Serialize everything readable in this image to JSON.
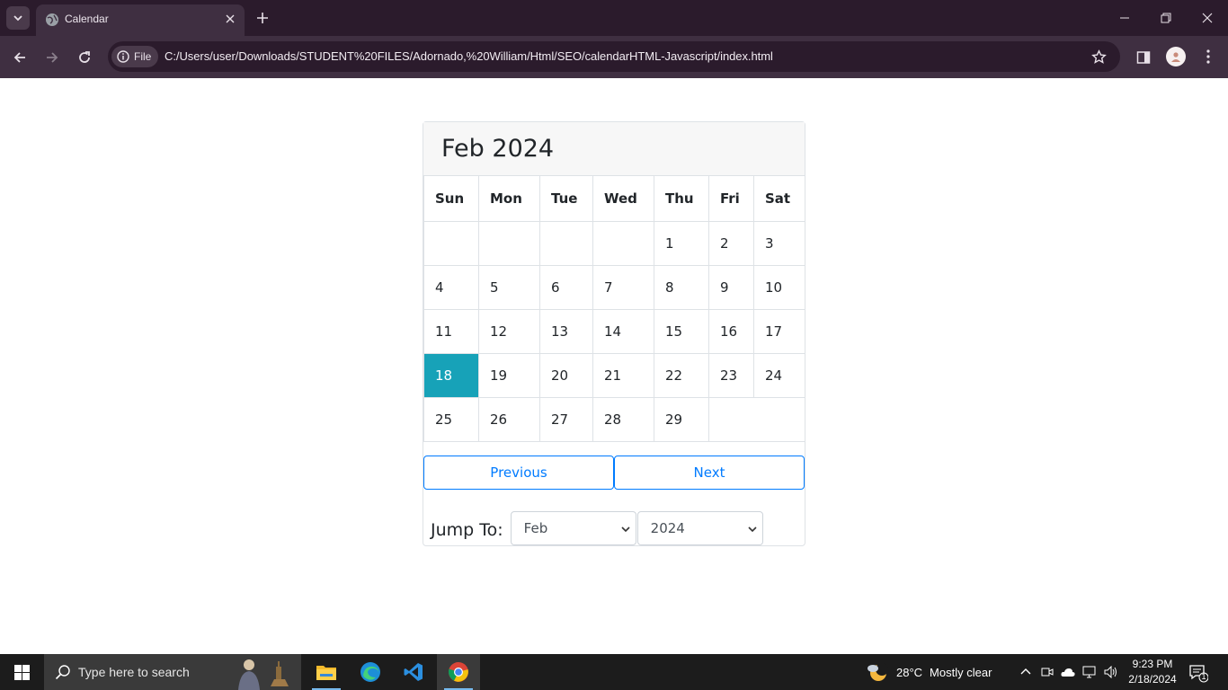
{
  "browser": {
    "tab_title": "Calendar",
    "site_chip_label": "File",
    "url": "C:/Users/user/Downloads/STUDENT%20FILES/Adornado,%20William/Html/SEO/calendarHTML-Javascript/index.html"
  },
  "calendar": {
    "title": "Feb 2024",
    "weekdays": [
      "Sun",
      "Mon",
      "Tue",
      "Wed",
      "Thu",
      "Fri",
      "Sat"
    ],
    "weeks": [
      [
        "",
        "",
        "",
        "",
        "1",
        "2",
        "3"
      ],
      [
        "4",
        "5",
        "6",
        "7",
        "8",
        "9",
        "10"
      ],
      [
        "11",
        "12",
        "13",
        "14",
        "15",
        "16",
        "17"
      ],
      [
        "18",
        "19",
        "20",
        "21",
        "22",
        "23",
        "24"
      ],
      [
        "25",
        "26",
        "27",
        "28",
        "29",
        "",
        ""
      ]
    ],
    "today": "18",
    "today_color": "#17a2b8",
    "previous_label": "Previous",
    "next_label": "Next",
    "jump_label": "Jump To:",
    "month_select_value": "Feb",
    "year_select_value": "2024",
    "accent_color": "#007bff"
  },
  "taskbar": {
    "search_placeholder": "Type here to search",
    "weather_temp": "28°C",
    "weather_desc": "Mostly clear",
    "time": "9:23 PM",
    "date": "2/18/2024",
    "notification_count": "1",
    "apps": [
      "file-explorer-icon",
      "edge-icon",
      "vscode-icon",
      "chrome-icon"
    ]
  }
}
